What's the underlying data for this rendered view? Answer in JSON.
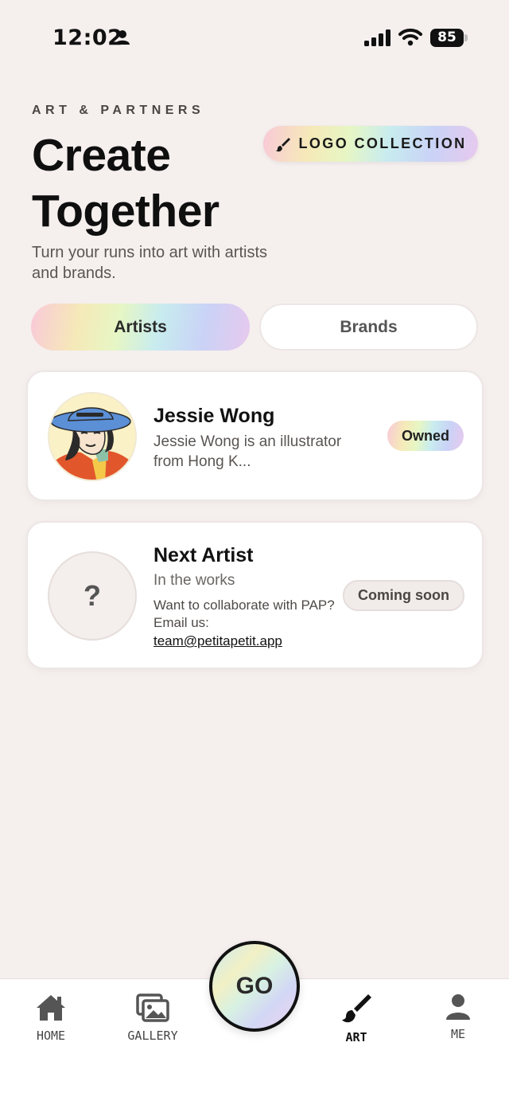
{
  "status_bar": {
    "time": "12:02",
    "battery": "85"
  },
  "header": {
    "eyebrow": "ART & PARTNERS",
    "title": "Create Together",
    "subtitle": "Turn your runs into art with artists and brands.",
    "logo_button": "LOGO COLLECTION"
  },
  "tabs": [
    {
      "label": "Artists",
      "active": true
    },
    {
      "label": "Brands",
      "active": false
    }
  ],
  "cards": [
    {
      "name": "Jessie Wong",
      "description": "Jessie Wong is an illustrator from Hong K...",
      "badge": "Owned"
    },
    {
      "name": "Next Artist",
      "subtitle": "In the works",
      "collab_text": "Want to collaborate with PAP? Email us:",
      "email": "team@petitapetit.app",
      "badge": "Coming soon",
      "placeholder_glyph": "?"
    }
  ],
  "bottom_nav": {
    "items": [
      {
        "label": "HOME",
        "icon": "home-icon"
      },
      {
        "label": "GALLERY",
        "icon": "gallery-icon"
      },
      {
        "label": "ART",
        "icon": "paintbrush-icon",
        "active": true
      },
      {
        "label": "ME",
        "icon": "person-icon"
      }
    ],
    "go_label": "GO"
  }
}
